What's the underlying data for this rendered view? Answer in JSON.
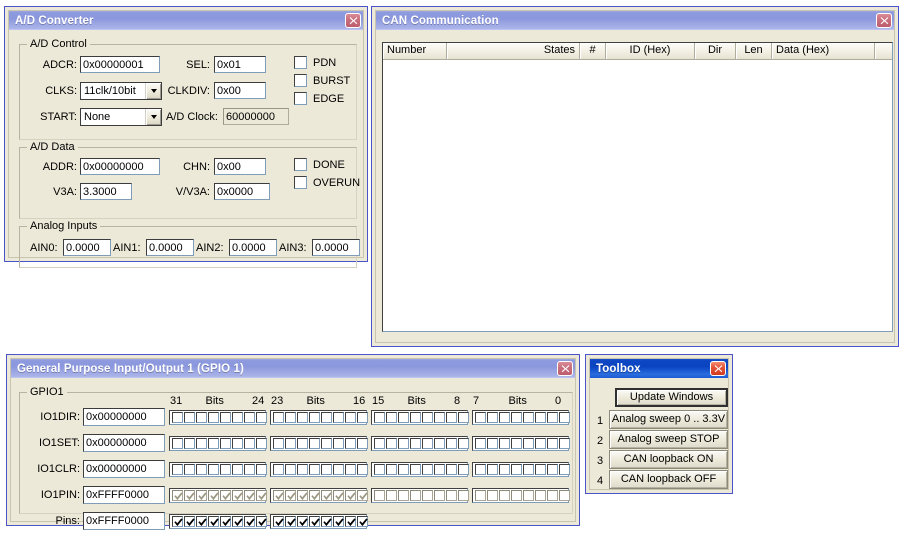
{
  "windows": {
    "adc": {
      "title": "A/D Converter",
      "close_icon": "close-icon",
      "control": {
        "legend": "A/D Control",
        "adcr_label": "ADCR:",
        "adcr_value": "0x00000001",
        "sel_label": "SEL:",
        "sel_value": "0x01",
        "clks_label": "CLKS:",
        "clks_value": "11clk/10bit",
        "clkdiv_label": "CLKDIV:",
        "clkdiv_value": "0x00",
        "start_label": "START:",
        "start_value": "None",
        "clock_label": "A/D Clock:",
        "clock_value": "60000000",
        "pdn_label": "PDN",
        "pdn_checked": false,
        "burst_label": "BURST",
        "burst_checked": false,
        "edge_label": "EDGE",
        "edge_checked": false
      },
      "data": {
        "legend": "A/D Data",
        "addr_label": "ADDR:",
        "addr_value": "0x00000000",
        "chn_label": "CHN:",
        "chn_value": "0x00",
        "v3a_label": "V3A:",
        "v3a_value": "3.3000",
        "vv3a_label": "V/V3A:",
        "vv3a_value": "0x0000",
        "done_label": "DONE",
        "done_checked": false,
        "overun_label": "OVERUN",
        "overun_checked": false
      },
      "analog": {
        "legend": "Analog Inputs",
        "inputs": [
          {
            "label": "AIN0:",
            "value": "0.0000"
          },
          {
            "label": "AIN1:",
            "value": "0.0000"
          },
          {
            "label": "AIN2:",
            "value": "0.0000"
          },
          {
            "label": "AIN3:",
            "value": "0.0000"
          }
        ]
      }
    },
    "can": {
      "title": "CAN Communication",
      "close_icon": "close-icon",
      "columns": [
        {
          "label": "Number",
          "align": "left"
        },
        {
          "label": "States",
          "align": "right"
        },
        {
          "label": "#",
          "align": "center"
        },
        {
          "label": "ID (Hex)",
          "align": "center"
        },
        {
          "label": "Dir",
          "align": "center"
        },
        {
          "label": "Len",
          "align": "center"
        },
        {
          "label": "Data (Hex)",
          "align": "left"
        },
        {
          "label": "",
          "align": "left"
        }
      ],
      "rows": []
    },
    "gpio": {
      "title": "General Purpose Input/Output 1 (GPIO 1)",
      "close_icon": "close-icon",
      "legend": "GPIO1",
      "bit_headers": [
        {
          "high": "31",
          "mid": "Bits",
          "low": "24"
        },
        {
          "high": "23",
          "mid": "Bits",
          "low": "16"
        },
        {
          "high": "15",
          "mid": "Bits",
          "low": "8"
        },
        {
          "high": "7",
          "mid": "Bits",
          "low": "0"
        }
      ],
      "registers": [
        {
          "label": "IO1DIR:",
          "value": "0x00000000",
          "state": "normal",
          "bits": "00000000000000000000000000000000",
          "groups": 4
        },
        {
          "label": "IO1SET:",
          "value": "0x00000000",
          "state": "normal",
          "bits": "00000000000000000000000000000000",
          "groups": 4
        },
        {
          "label": "IO1CLR:",
          "value": "0x00000000",
          "state": "normal",
          "bits": "00000000000000000000000000000000",
          "groups": 4
        },
        {
          "label": "IO1PIN:",
          "value": "0xFFFF0000",
          "state": "disabled",
          "bits": "11111111111111110000000000000000",
          "groups": 4
        },
        {
          "label": "Pins:",
          "value": "0xFFFF0000",
          "state": "normal",
          "bits": "1111111111111111",
          "groups": 2
        }
      ]
    },
    "toolbox": {
      "title": "Toolbox",
      "close_icon": "close-icon",
      "update_label": "Update Windows",
      "actions": [
        {
          "num": "1",
          "label": "Analog sweep 0 .. 3.3V"
        },
        {
          "num": "2",
          "label": "Analog sweep STOP"
        },
        {
          "num": "3",
          "label": "CAN loopback ON"
        },
        {
          "num": "4",
          "label": "CAN loopback OFF"
        }
      ]
    }
  },
  "colors": {
    "face": "#ece9d8",
    "window_border": "#4a53c8",
    "title_inactive": "#8c98dd",
    "title_active": "#0b43c0",
    "close_inactive": "#bd5c6c",
    "close_active": "#d33a1e"
  }
}
